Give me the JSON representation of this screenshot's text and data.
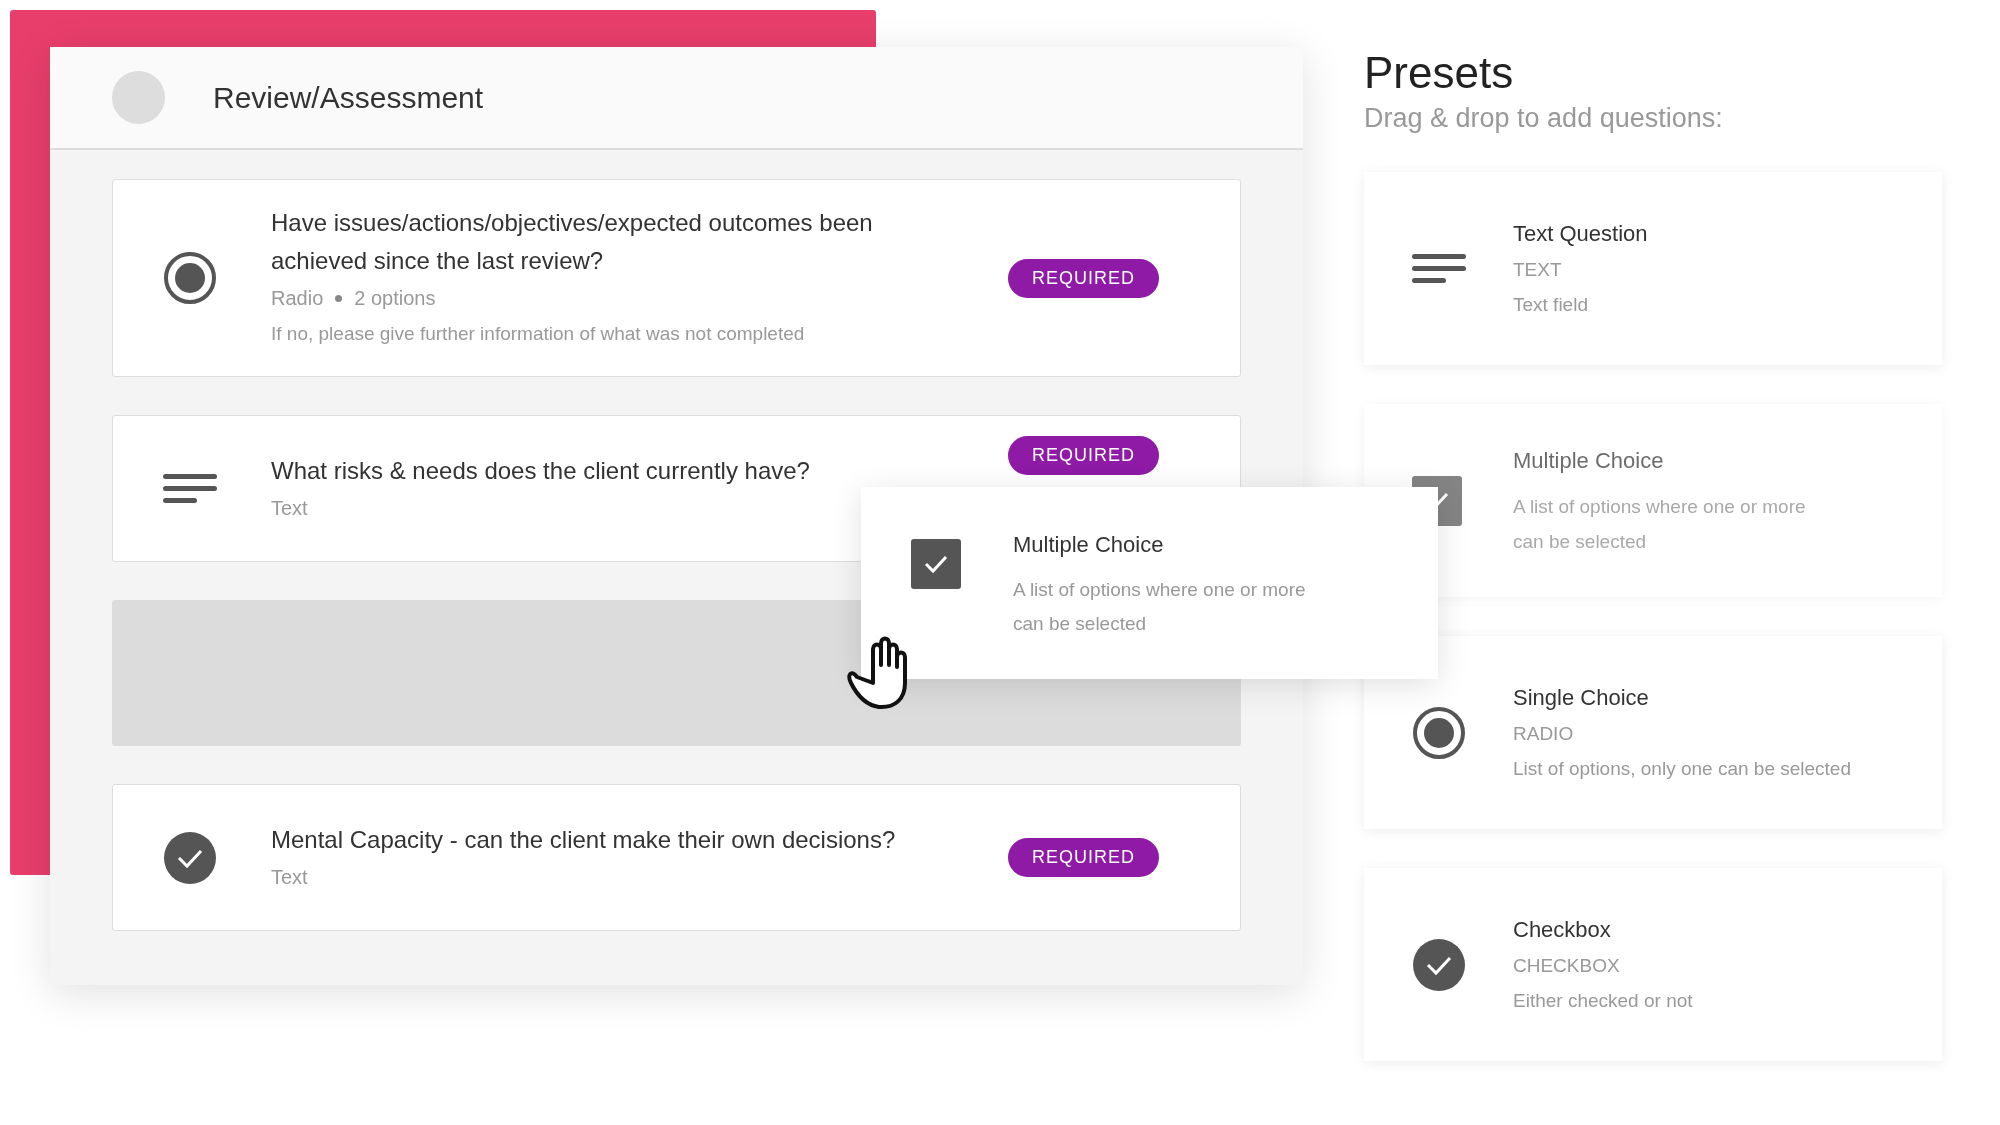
{
  "form": {
    "title": "Review/Assessment",
    "questions": [
      {
        "kind": "radio",
        "text": "Have issues/actions/objectives/expected outcomes been achieved since the last review?",
        "type": "Radio",
        "meta": "2 options",
        "hint": "If no, please give further information of what was not completed",
        "badge": "REQUIRED"
      },
      {
        "kind": "text",
        "text": "What risks & needs does the client currently have?",
        "type": "Text",
        "badge": "REQUIRED"
      },
      {
        "kind": "drop_zone"
      },
      {
        "kind": "checkbox",
        "text": "Mental Capacity - can the client make their own decisions?",
        "type": "Text",
        "badge": "REQUIRED"
      }
    ]
  },
  "dragged": {
    "kind": "multiple",
    "title": "Multiple Choice",
    "description": "A list of options where one or more can be selected"
  },
  "presets": {
    "title": "Presets",
    "subtitle": "Drag & drop to add questions:",
    "items": [
      {
        "kind": "text",
        "title": "Text Question",
        "type": "TEXT",
        "description": "Text field",
        "disabled": false
      },
      {
        "kind": "multiple",
        "title": "Multiple Choice",
        "description": "A list of options where one or more can be selected",
        "disabled": true
      },
      {
        "kind": "radio",
        "title": "Single Choice",
        "type": "RADIO",
        "description": "List of options, only one can be selected",
        "disabled": false
      },
      {
        "kind": "checkbox",
        "title": "Checkbox",
        "type": "CHECKBOX",
        "description": "Either checked or not",
        "disabled": false
      }
    ]
  }
}
